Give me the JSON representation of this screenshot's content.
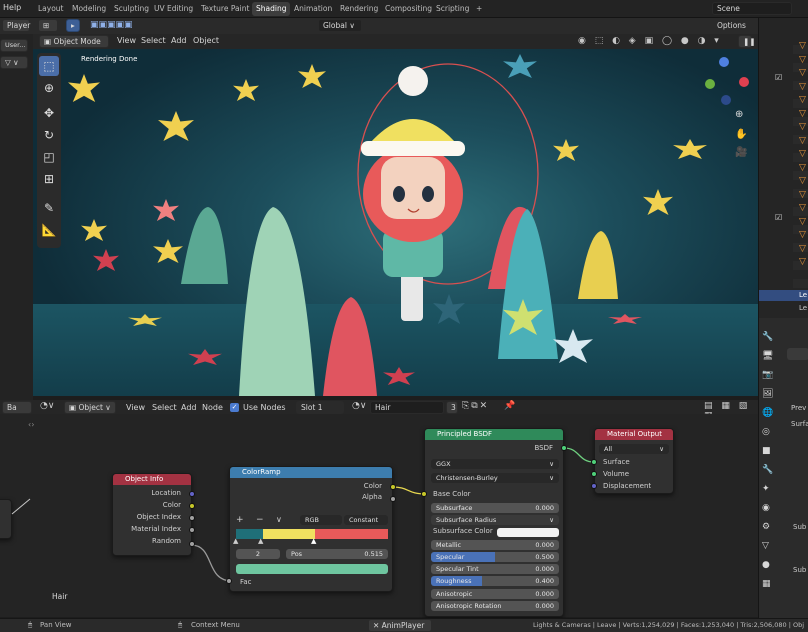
{
  "topbar": {
    "menu_help": "Help",
    "workspaces": [
      "Layout",
      "Modeling",
      "Sculpting",
      "UV Editing",
      "Texture Paint",
      "Shading",
      "Animation",
      "Rendering",
      "Compositing",
      "Scripting"
    ],
    "active_workspace": "Shading",
    "add_tab": "+",
    "scene_name": "Scene"
  },
  "left": {
    "player_label": "Player",
    "user_label": "User..."
  },
  "viewport_header": {
    "mode": "Object Mode",
    "menus": [
      "View",
      "Select",
      "Add",
      "Object"
    ],
    "transform": "Global",
    "options": "Options"
  },
  "viewport": {
    "render_status": "Rendering Done"
  },
  "node_header": {
    "editor_type": "Ba",
    "object": "Object",
    "menus": [
      "View",
      "Select",
      "Add",
      "Node"
    ],
    "use_nodes_label": "Use Nodes",
    "slot": "Slot 1",
    "material": "Hair",
    "users": "3"
  },
  "nodes": {
    "object_info": {
      "title": "Object Info",
      "outputs": [
        "Location",
        "Color",
        "Object Index",
        "Material Index",
        "Random"
      ]
    },
    "colorramp": {
      "title": "ColorRamp",
      "outputs": [
        "Color",
        "Alpha"
      ],
      "add": "+",
      "remove": "−",
      "menu": "∨",
      "mode": "RGB",
      "interpolation": "Constant",
      "index": "2",
      "pos_label": "Pos",
      "pos_value": "0.515",
      "input": "Fac",
      "stops": [
        "#1f6f78",
        "#f0e060",
        "#e85a5a"
      ],
      "selected_color": "#6fc6a0"
    },
    "principled": {
      "title": "Principled BSDF",
      "output": "BSDF",
      "distribution": "GGX",
      "subsurface_method": "Christensen-Burley",
      "base_color": "Base Color",
      "rows": [
        {
          "label": "Subsurface",
          "value": "0.000"
        },
        {
          "label": "Subsurface Radius",
          "value": ""
        },
        {
          "label": "Subsurface Color",
          "value": ""
        },
        {
          "label": "Metallic",
          "value": "0.000"
        },
        {
          "label": "Specular",
          "value": "0.500"
        },
        {
          "label": "Specular Tint",
          "value": "0.000"
        },
        {
          "label": "Roughness",
          "value": "0.400"
        },
        {
          "label": "Anisotropic",
          "value": "0.000"
        },
        {
          "label": "Anisotropic Rotation",
          "value": "0.000"
        }
      ]
    },
    "material_output": {
      "title": "Material Output",
      "target": "All",
      "inputs": [
        "Surface",
        "Volume",
        "Displacement"
      ]
    }
  },
  "node_editor": {
    "material_label": "Hair"
  },
  "statusbar": {
    "pan_view": "Pan View",
    "context_menu": "Context Menu",
    "anim_player": "AnimPlayer",
    "stats": "Lights & Cameras | Leave | Verts:1,254,029 | Faces:1,253,040 | Tris:2,506,080 | Obj"
  },
  "right_panel": {
    "items": [
      "Le",
      "Le",
      "Prev",
      "Surfa",
      "Sub",
      "Sub"
    ]
  },
  "colors": {
    "accent": "#4b6ea8",
    "node_object_info": "#a33242",
    "node_colorramp": "#3d7dae",
    "node_principled": "#2f8a5a",
    "node_output": "#a33242"
  }
}
